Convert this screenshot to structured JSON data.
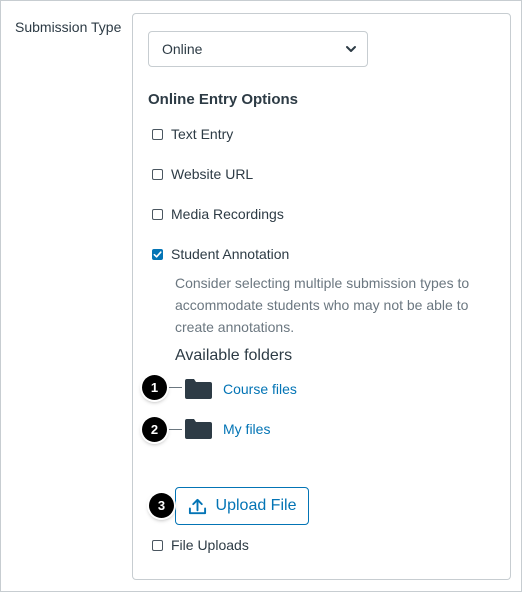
{
  "submission": {
    "label": "Submission Type",
    "select_value": "Online"
  },
  "entry_options": {
    "heading": "Online Entry Options",
    "text_entry": {
      "label": "Text Entry",
      "checked": false
    },
    "website_url": {
      "label": "Website URL",
      "checked": false
    },
    "media_recordings": {
      "label": "Media Recordings",
      "checked": false
    },
    "student_annotation": {
      "label": "Student Annotation",
      "checked": true
    },
    "annotation_hint": "Consider selecting multiple submission types to accommodate students who may not be able to create annotations."
  },
  "folders": {
    "title": "Available folders",
    "course_files": "Course files",
    "my_files": "My files"
  },
  "upload": {
    "label": "Upload File"
  },
  "file_uploads": {
    "label": "File Uploads",
    "checked": false
  },
  "callouts": {
    "one": "1",
    "two": "2",
    "three": "3"
  },
  "icons": {
    "select": "chevron-down-icon",
    "folder": "folder-icon",
    "upload": "upload-icon",
    "check": "checkmark-icon"
  },
  "colors": {
    "accent": "#0374b5",
    "text": "#2d3b45",
    "muted": "#6b7780",
    "border": "#c7cdd1"
  }
}
